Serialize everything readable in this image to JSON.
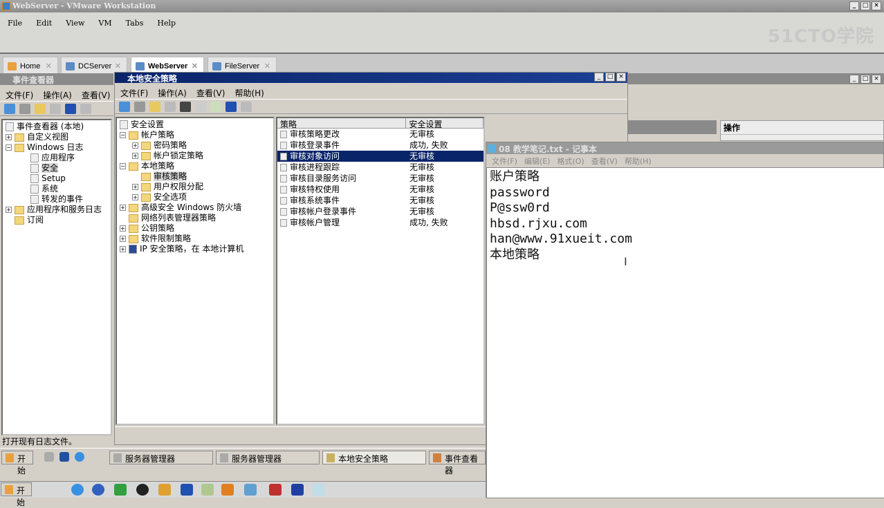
{
  "vmware": {
    "title": "WebServer - VMware Workstation",
    "menu": [
      "File",
      "Edit",
      "View",
      "VM",
      "Tabs",
      "Help"
    ],
    "watermark": "51CTO学院",
    "tabs": [
      {
        "label": "Home"
      },
      {
        "label": "DCServer"
      },
      {
        "label": "WebServer"
      },
      {
        "label": "FileServer"
      }
    ]
  },
  "event_viewer": {
    "title": "事件查看器",
    "menu": [
      "文件(F)",
      "操作(A)",
      "查看(V)"
    ],
    "tree": [
      "事件查看器 (本地)",
      "自定义视图",
      "Windows 日志",
      "应用程序",
      "安全",
      "Setup",
      "系统",
      "转发的事件",
      "应用程序和服务日志",
      "订阅"
    ],
    "status": "打开现有日志文件。",
    "actions_header": "操作"
  },
  "secpol": {
    "title": "本地安全策略",
    "menu": [
      "文件(F)",
      "操作(A)",
      "查看(V)",
      "帮助(H)"
    ],
    "tree": [
      "安全设置",
      "帐户策略",
      "密码策略",
      "帐户锁定策略",
      "本地策略",
      "审核策略",
      "用户权限分配",
      "安全选项",
      "高级安全 Windows 防火墙",
      "网络列表管理器策略",
      "公钥策略",
      "软件限制策略",
      "IP 安全策略，在 本地计算机"
    ],
    "columns": [
      "策略",
      "安全设置"
    ],
    "rows": [
      {
        "policy": "审核策略更改",
        "setting": "无审核"
      },
      {
        "policy": "审核登录事件",
        "setting": "成功, 失败"
      },
      {
        "policy": "审核对象访问",
        "setting": "无审核"
      },
      {
        "policy": "审核进程跟踪",
        "setting": "无审核"
      },
      {
        "policy": "审核目录服务访问",
        "setting": "无审核"
      },
      {
        "policy": "审核特权使用",
        "setting": "无审核"
      },
      {
        "policy": "审核系统事件",
        "setting": "无审核"
      },
      {
        "policy": "审核帐户登录事件",
        "setting": "无审核"
      },
      {
        "policy": "审核帐户管理",
        "setting": "成功, 失败"
      }
    ]
  },
  "notepad": {
    "title": "08 教学笔记.txt - 记事本",
    "menu": [
      "文件(F)",
      "编辑(E)",
      "格式(O)",
      "查看(V)",
      "帮助(H)"
    ],
    "lines": [
      "账户策略",
      "password",
      "P@ssw0rd",
      "hbsd.rjxu.com",
      "han@www.91xueit.com",
      "本地策略"
    ]
  },
  "guest_taskbar": {
    "start": "开始",
    "buttons": [
      "服务器管理器",
      "服务器管理器",
      "本地安全策略",
      "事件查看器"
    ]
  },
  "host_taskbar": {
    "start": "开始"
  }
}
